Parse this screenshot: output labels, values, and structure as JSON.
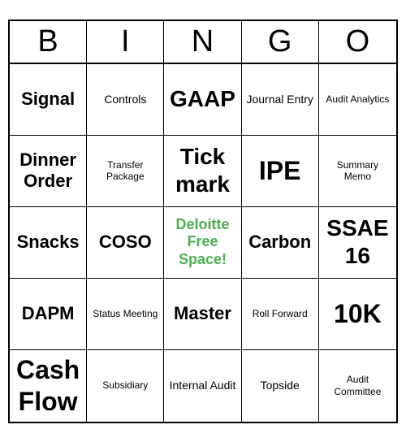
{
  "title": "BINGO",
  "header": {
    "letters": [
      "B",
      "I",
      "N",
      "G",
      "O"
    ]
  },
  "cells": [
    {
      "text": "Signal",
      "size": "large",
      "color": "normal"
    },
    {
      "text": "Controls",
      "size": "normal",
      "color": "normal"
    },
    {
      "text": "GAAP",
      "size": "xlarge",
      "color": "normal"
    },
    {
      "text": "Journal Entry",
      "size": "normal",
      "color": "normal"
    },
    {
      "text": "Audit Analytics",
      "size": "small",
      "color": "normal"
    },
    {
      "text": "Dinner Order",
      "size": "large",
      "color": "normal"
    },
    {
      "text": "Transfer Package",
      "size": "small",
      "color": "normal"
    },
    {
      "text": "Tick mark",
      "size": "xlarge",
      "color": "normal"
    },
    {
      "text": "IPE",
      "size": "xxlarge",
      "color": "normal"
    },
    {
      "text": "Summary Memo",
      "size": "small",
      "color": "normal"
    },
    {
      "text": "Snacks",
      "size": "large",
      "color": "normal"
    },
    {
      "text": "COSO",
      "size": "large",
      "color": "normal"
    },
    {
      "text": "Deloitte Free Space!",
      "size": "normal",
      "color": "green"
    },
    {
      "text": "Carbon",
      "size": "large",
      "color": "normal"
    },
    {
      "text": "SSAE 16",
      "size": "xlarge",
      "color": "normal"
    },
    {
      "text": "DAPM",
      "size": "large",
      "color": "normal"
    },
    {
      "text": "Status Meeting",
      "size": "small",
      "color": "normal"
    },
    {
      "text": "Master",
      "size": "large",
      "color": "normal"
    },
    {
      "text": "Roll Forward",
      "size": "small",
      "color": "normal"
    },
    {
      "text": "10K",
      "size": "xxlarge",
      "color": "normal"
    },
    {
      "text": "Cash Flow",
      "size": "xxlarge",
      "color": "normal"
    },
    {
      "text": "Subsidiary",
      "size": "small",
      "color": "normal"
    },
    {
      "text": "Internal Audit",
      "size": "normal",
      "color": "normal"
    },
    {
      "text": "Topside",
      "size": "normal",
      "color": "normal"
    },
    {
      "text": "Audit Committee",
      "size": "small",
      "color": "normal"
    }
  ]
}
